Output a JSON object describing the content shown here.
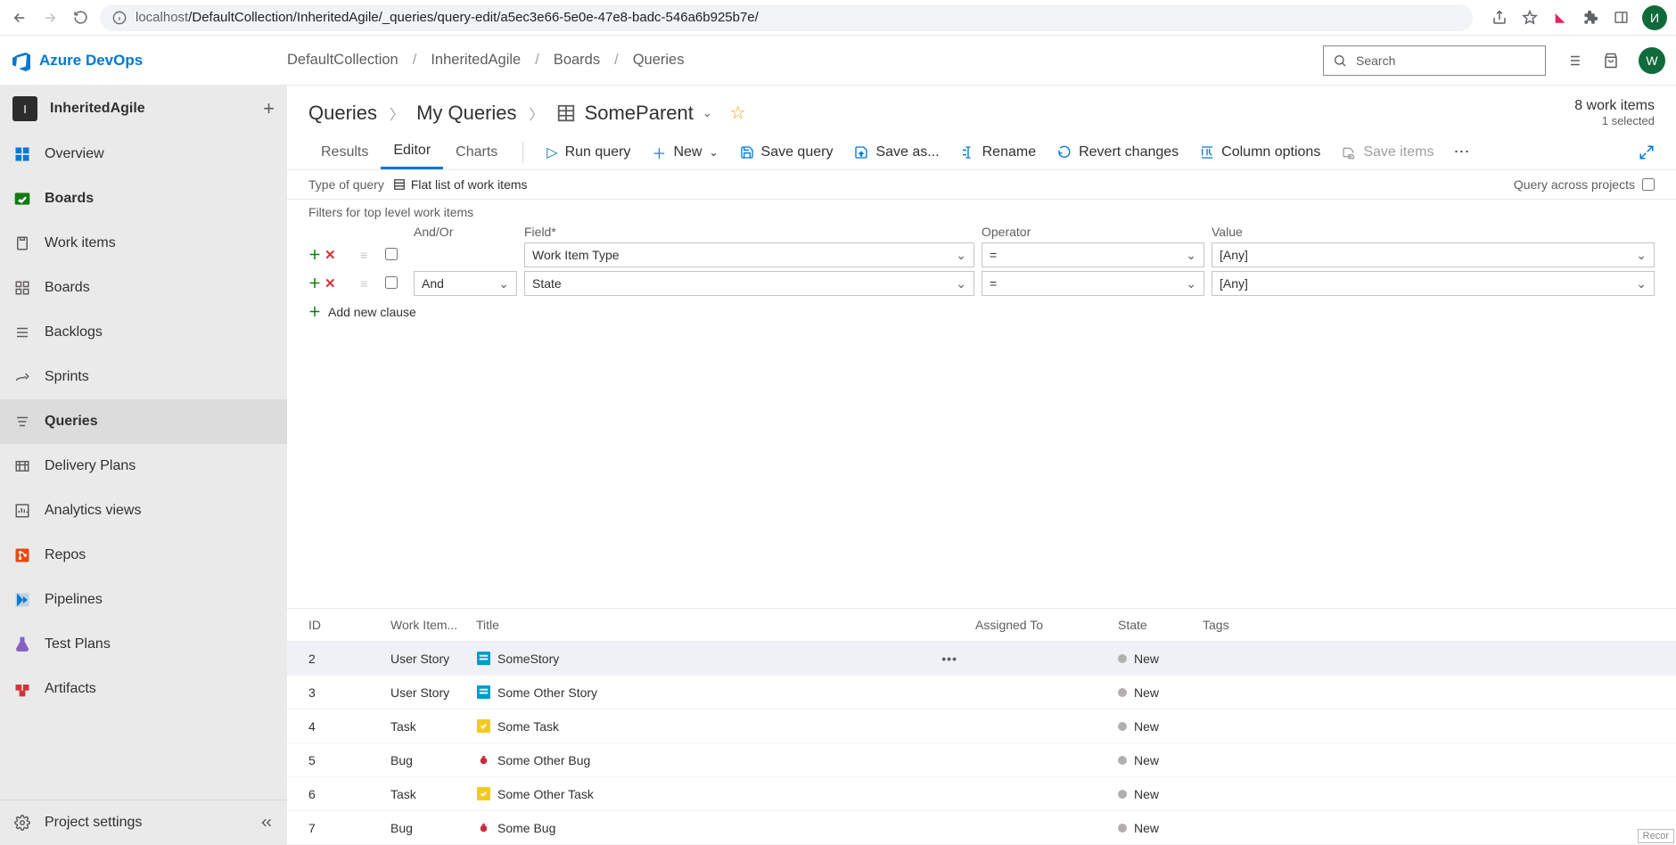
{
  "browser": {
    "url_prefix": "localhost",
    "url_path": "/DefaultCollection/InheritedAgile/_queries/query-edit/a5ec3e66-5e0e-47e8-badc-546a6b925b7e/",
    "avatar_initial": "И"
  },
  "header": {
    "product": "Azure DevOps",
    "crumbs": [
      "DefaultCollection",
      "InheritedAgile",
      "Boards",
      "Queries"
    ],
    "search_placeholder": "Search",
    "avatar_initial": "W"
  },
  "sidebar": {
    "project_initial": "I",
    "project_name": "InheritedAgile",
    "items": [
      {
        "label": "Overview",
        "icon": "overview"
      },
      {
        "label": "Boards",
        "icon": "boards"
      },
      {
        "label": "Work items",
        "icon": "workitems",
        "sub": true
      },
      {
        "label": "Boards",
        "icon": "board-grid",
        "sub": true
      },
      {
        "label": "Backlogs",
        "icon": "backlogs",
        "sub": true
      },
      {
        "label": "Sprints",
        "icon": "sprints",
        "sub": true
      },
      {
        "label": "Queries",
        "icon": "queries",
        "sub": true,
        "selected": true
      },
      {
        "label": "Delivery Plans",
        "icon": "delivery",
        "sub": true
      },
      {
        "label": "Analytics views",
        "icon": "analytics",
        "sub": true
      },
      {
        "label": "Repos",
        "icon": "repos"
      },
      {
        "label": "Pipelines",
        "icon": "pipelines"
      },
      {
        "label": "Test Plans",
        "icon": "testplans"
      },
      {
        "label": "Artifacts",
        "icon": "artifacts"
      }
    ],
    "settings_label": "Project settings"
  },
  "title": {
    "root": "Queries",
    "folder": "My Queries",
    "name": "SomeParent",
    "count_text": "8 work items",
    "selected_text": "1 selected"
  },
  "tabs": {
    "results": "Results",
    "editor": "Editor",
    "charts": "Charts"
  },
  "toolbar": {
    "run": "Run query",
    "new": "New",
    "save": "Save query",
    "saveas": "Save as...",
    "rename": "Rename",
    "revert": "Revert changes",
    "columns": "Column options",
    "saveitems": "Save items"
  },
  "querytype": {
    "label": "Type of query",
    "value": "Flat list of work items",
    "across_label": "Query across projects"
  },
  "filters": {
    "section_title": "Filters for top level work items",
    "headers": {
      "andor": "And/Or",
      "field": "Field*",
      "operator": "Operator",
      "value": "Value"
    },
    "rows": [
      {
        "andor": "",
        "field": "Work Item Type",
        "op": "=",
        "value": "[Any]"
      },
      {
        "andor": "And",
        "field": "State",
        "op": "=",
        "value": "[Any]"
      }
    ],
    "add_clause": "Add new clause"
  },
  "results": {
    "headers": {
      "id": "ID",
      "type": "Work Item...",
      "title": "Title",
      "assigned": "Assigned To",
      "state": "State",
      "tags": "Tags"
    },
    "rows": [
      {
        "id": "2",
        "type": "User Story",
        "title": "SomeStory",
        "icon": "story",
        "state": "New",
        "selected": true,
        "menu": true
      },
      {
        "id": "3",
        "type": "User Story",
        "title": "Some Other Story",
        "icon": "story",
        "state": "New"
      },
      {
        "id": "4",
        "type": "Task",
        "title": "Some Task",
        "icon": "task",
        "state": "New"
      },
      {
        "id": "5",
        "type": "Bug",
        "title": "Some Other Bug",
        "icon": "bug",
        "state": "New"
      },
      {
        "id": "6",
        "type": "Task",
        "title": "Some Other Task",
        "icon": "task",
        "state": "New"
      },
      {
        "id": "7",
        "type": "Bug",
        "title": "Some Bug",
        "icon": "bug",
        "state": "New"
      }
    ]
  },
  "icon_colors": {
    "story": "#009CCC",
    "task": "#F2CB1D",
    "bug": "#CC293D"
  }
}
